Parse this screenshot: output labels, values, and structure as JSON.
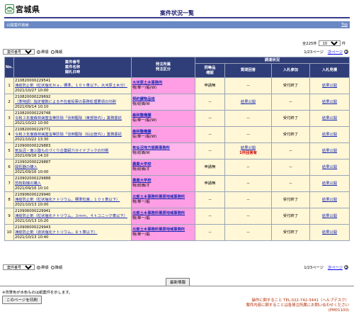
{
  "brand": {
    "name": "宮城県",
    "logo_icon": "miyagi-pref-logo"
  },
  "page_title": "案件状況一覧",
  "section": {
    "label": "公開案件検索",
    "top_link": "Top"
  },
  "total": {
    "label": "全225件",
    "per_page": "10",
    "per_page_suffix": "件"
  },
  "sort": {
    "options": [
      "案件番号"
    ],
    "selected": "案件番号",
    "asc_label": "昇順",
    "desc_label": "降順",
    "selected_order": "asc"
  },
  "pager": {
    "page_text": "1/23ページ",
    "next_label": "次ページ"
  },
  "table": {
    "headers": {
      "no": "No.",
      "case": [
        "案件番号",
        "案件名称",
        "開札日時"
      ],
      "org": [
        "発注所属",
        "発注区分"
      ],
      "status_group": "調達状況",
      "status": [
        "同等品",
        "確認",
        "質問回答",
        "入札参加",
        "入札見積"
      ]
    },
    "rows": [
      {
        "no": "1",
        "id": "210820000229541",
        "name": "凍結防止剤（粒状塩化Ｎａ，標準，１０ｔ車以下，大河原土木分）",
        "date": "2021/10/27 10:00",
        "org": "大河原土木事務所",
        "type": "物/単一/般(W)",
        "eq": "申請無",
        "qa": "－",
        "part": "受付終了",
        "bid": "結果公開",
        "org_alt": false
      },
      {
        "no": "2",
        "id": "210820000229692",
        "name": "（準特調）指定複数による不在者投票の事務処理要領の印刷",
        "date": "2021/09/14 10:10",
        "org": "契約課物品班",
        "type": "物/総価/W",
        "eq": "－",
        "qa": "結果公開",
        "part": "－",
        "bid": "結果公開",
        "org_alt": true
      },
      {
        "no": "3",
        "id": "210820000229748",
        "name": "令和３年度森林病害虫等防除「伐倒駆除（東部管内）」業務委託",
        "date": "2021/10/22 10:00",
        "org": "森林整備課",
        "type": "役/単一/般(W)",
        "eq": "－",
        "qa": "－",
        "part": "受付終了",
        "bid": "結果公開",
        "org_alt": false
      },
      {
        "no": "4",
        "id": "210820000229771",
        "name": "令和３年度森林病害虫等防除「伐倒駆除（仙台管内）」業務委託",
        "date": "2021/10/22 13:30",
        "org": "森林整備課",
        "type": "役/単一/般(W)",
        "eq": "－",
        "qa": "－",
        "part": "受付終了",
        "bid": "結果公開",
        "org_alt": false
      },
      {
        "no": "5",
        "id": "210900000229883",
        "name": "気仙沼・南三陸ものづくり企業紹介ガイドブックの印刷",
        "date": "2021/09/16 14:10",
        "org": "気仙沼地方振興事務所",
        "type": "物/総価/W",
        "eq": "－",
        "qa": "結果公開",
        "qa_note": "1件回答有",
        "part": "－",
        "bid": "結果公開",
        "org_alt": true
      },
      {
        "no": "6",
        "id": "210902000229887",
        "name": "開拓器の購入",
        "date": "2021/09/16 10:00",
        "org": "農業大学校",
        "type": "物/総価/才",
        "eq": "申請無",
        "qa": "－",
        "part": "－",
        "bid": "結果公開",
        "org_alt": false
      },
      {
        "no": "7",
        "id": "210902000229888",
        "name": "剪枝取機の購入",
        "date": "2021/09/16 10:10",
        "org": "農業大学校",
        "type": "物/総価/才",
        "eq": "申請無",
        "qa": "－",
        "part": "－",
        "bid": "結果公開",
        "org_alt": false
      },
      {
        "no": "8",
        "id": "210906000229940",
        "name": "凍結防止剤（粒状塩化ナトリウム，標準粒度，１０ｔ車以下）",
        "date": "2021/10/13 10:00",
        "org": "北部土木事務所栗原地域事務所",
        "type": "物/単一/般",
        "eq": "－",
        "qa": "－",
        "part": "受付終了",
        "bid": "結果公開",
        "org_alt": false
      },
      {
        "no": "9",
        "id": "210906000229941",
        "name": "凍結防止剤（粒状塩化ナトリウム，３ｍｍ，４ｔユニック車以下）",
        "date": "2021/10/13 10:20",
        "org": "北部土木事務所栗原地域事務所",
        "type": "物/単一/般",
        "eq": "－",
        "qa": "－",
        "part": "受付終了",
        "bid": "結果公開",
        "org_alt": false
      },
      {
        "no": "10",
        "id": "210906000229943",
        "name": "凍結防止剤（液状塩化ナトリウム，８ｔ車以下）",
        "date": "2021/10/13 10:40",
        "org": "北部土木事務所栗原地域事務所",
        "type": "物/単一/般",
        "eq": "－",
        "qa": "－",
        "part": "受付終了",
        "bid": "結果公開",
        "org_alt": false
      }
    ]
  },
  "refresh_label": "最新情報",
  "note": "※背景色が水色ものは紙案件を示します。",
  "print_label": "このページを印刷",
  "contact": {
    "line1": "操作に関すること TEL:022-742-3441（ヘルプデスク）",
    "line2": "案件内容に関することは各発注所属にお問い合わせください",
    "line3": "(PM01100)"
  },
  "colors": {
    "header_bg": "#2f3d79",
    "section_bar": "#6a88c4",
    "org_cell": "#ff9ee4",
    "row_bg": "#fff7d6",
    "contact_text": "#b32b00"
  }
}
